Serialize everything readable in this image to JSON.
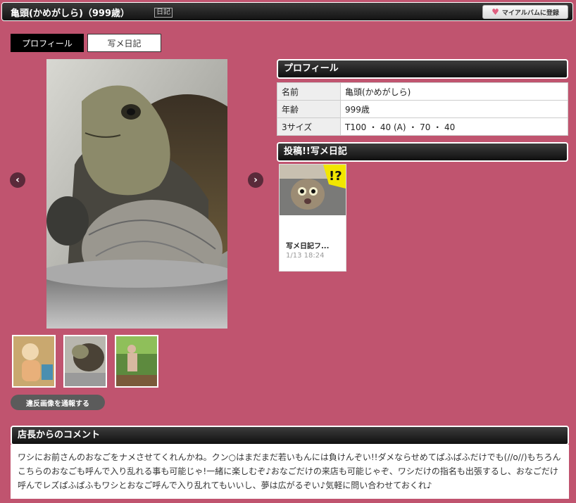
{
  "header": {
    "title": "亀頭(かめがしら)（999歳）",
    "diary_tag": "日記",
    "album_button": "マイアルバムに登録",
    "album_icon": "heart-icon"
  },
  "tabs": [
    {
      "label": "プロフィール",
      "active": true
    },
    {
      "label": "写メ日記",
      "active": false
    }
  ],
  "gallery": {
    "prev_label": "‹",
    "next_label": "›",
    "thumbnails": [
      "cartoon-thumb",
      "turtle-thumb",
      "photo-thumb"
    ],
    "report_button": "違反画像を通報する"
  },
  "profile": {
    "heading": "プロフィール",
    "rows": [
      {
        "key": "名前",
        "value": "亀頭(かめがしら)"
      },
      {
        "key": "年齢",
        "value": "999歳"
      },
      {
        "key": "3サイズ",
        "value": "T100 ・ 40 (A) ・ 70 ・ 40"
      }
    ]
  },
  "diary": {
    "heading": "投稿!!写メ日記",
    "entries": [
      {
        "title": "写メ日記フ...",
        "date": "1/13 18:24"
      }
    ]
  },
  "comment": {
    "heading": "店長からのコメント",
    "text": "ワシにお前さんのおなごをナメさせてくれんかね。クン○はまだまだ若いもんには負けんぞい!!ダメならせめてぱふぱふだけでも(//o//)もちろんこちらのおなごも呼んで入り乱れる事も可能じゃ!一緒に楽しむぞ♪おなごだけの来店も可能じゃぞ、ワシだけの指名も出張するし、おなごだけ呼んでレズぱふぱふもワシとおなご呼んで入り乱れてもいいし、夢は広がるぞい♪気軽に問い合わせておくれ♪"
  },
  "colors": {
    "background": "#c0546f",
    "header_dark": "#1a1a1a",
    "report_button": "#5b5b5b"
  }
}
